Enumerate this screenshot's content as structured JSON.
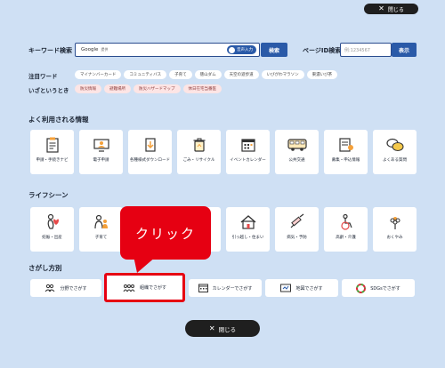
{
  "close_label": "閉じる",
  "keyword_label": "キーワード検索",
  "search_placeholder_brand": "Google",
  "search_placeholder_suffix": "提供",
  "voice_input_label": "音声入力",
  "search_button": "検索",
  "page_id_label": "ページID検索",
  "page_id_placeholder": "例:1234567",
  "display_button": "表示",
  "attention_label": "注目ワード",
  "attention_tags": [
    "マイナンバーカード",
    "コミュニティバス",
    "子育て",
    "徳山ダム",
    "天空の遊歩道",
    "いびがわマラソン",
    "東濃いび茶"
  ],
  "emergency_label": "いざというとき",
  "emergency_tags": [
    "防災情報",
    "避難場所",
    "防災ハザードマップ",
    "休日在宅当番医"
  ],
  "frequent_title": "よく利用される情報",
  "frequent_items": [
    {
      "label": "申請・手続きナビ",
      "icon": "clipboard-icon"
    },
    {
      "label": "電子申請",
      "icon": "computer-user-icon"
    },
    {
      "label": "各種様式ダウンロード",
      "icon": "document-download-icon"
    },
    {
      "label": "ごみ・リサイクル",
      "icon": "trash-icon"
    },
    {
      "label": "イベントカレンダー",
      "icon": "calendar-icon"
    },
    {
      "label": "公共交通",
      "icon": "bus-icon"
    },
    {
      "label": "募集・申込情報",
      "icon": "application-form-icon"
    },
    {
      "label": "よくある質問",
      "icon": "speech-bubbles-icon"
    }
  ],
  "life_title": "ライフシーン",
  "life_items": [
    {
      "label": "妊娠・出産",
      "icon": "pregnancy-icon"
    },
    {
      "label": "子育て",
      "icon": "parenting-icon"
    },
    {
      "label": "",
      "icon": "hidden-icon"
    },
    {
      "label": "",
      "icon": "hidden-icon"
    },
    {
      "label": "引っ越し・住まい",
      "icon": "house-icon"
    },
    {
      "label": "病気・予防",
      "icon": "syringe-icon"
    },
    {
      "label": "高齢・介護",
      "icon": "wheelchair-icon"
    },
    {
      "label": "おくやみ",
      "icon": "flower-icon"
    }
  ],
  "search_by_title": "さがし方別",
  "search_by_items": [
    {
      "label": "分野でさがす",
      "icon": "people-icon"
    },
    {
      "label": "組織でさがす",
      "icon": "organization-icon"
    },
    {
      "label": "カレンダーでさがす",
      "icon": "calendar-icon"
    },
    {
      "label": "地図でさがす",
      "icon": "map-icon"
    },
    {
      "label": "SDGsでさがす",
      "icon": "sdgs-wheel-icon"
    }
  ],
  "callout_text": "クリック",
  "colors": {
    "background": "#cfe0f4",
    "brand_blue": "#2a5aa8",
    "callout_red": "#e60012"
  }
}
